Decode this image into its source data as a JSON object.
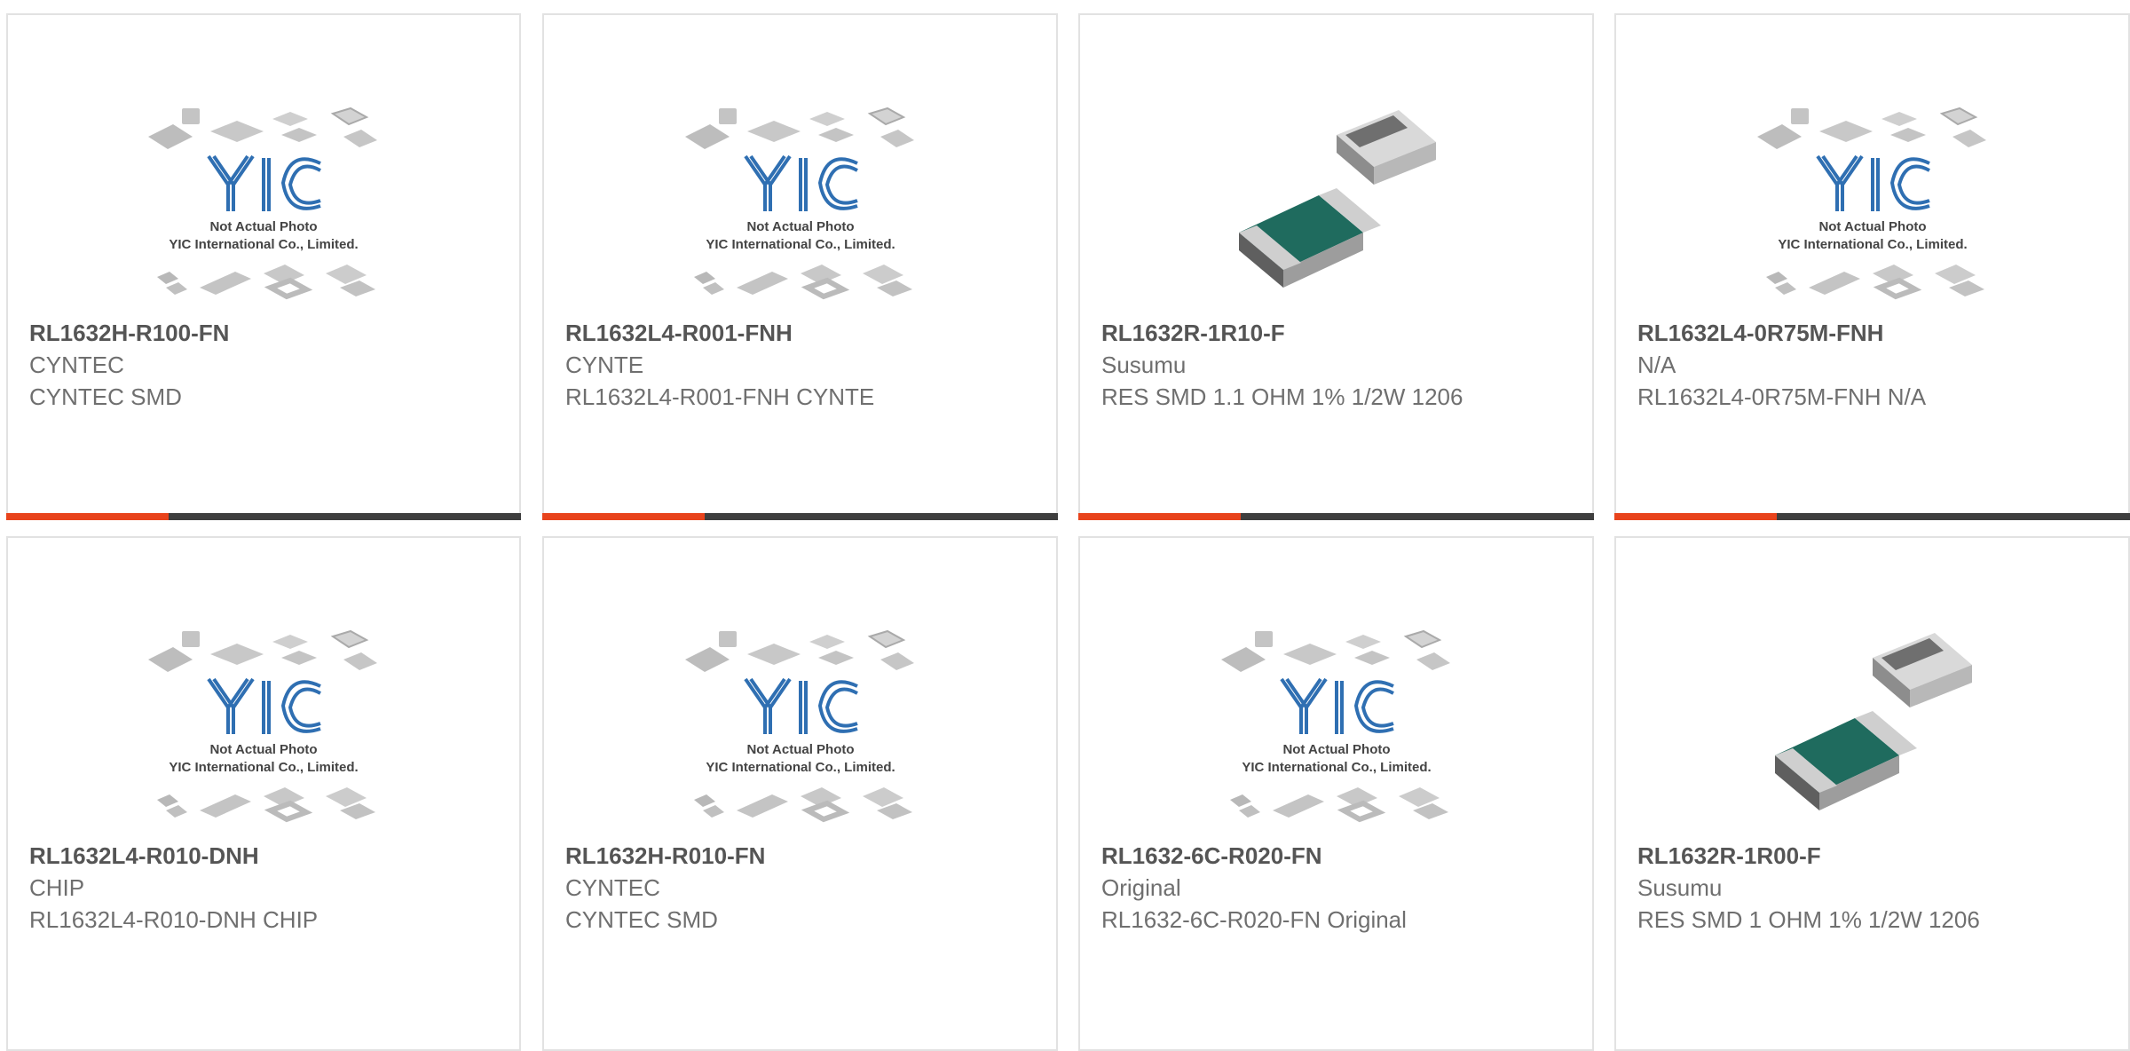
{
  "colors": {
    "accent": "#e8431c",
    "bar_dark": "#3e3e3e",
    "yic_logo_blue": "#2f6fb2",
    "resistor_body": "#1f6b5e"
  },
  "products": [
    {
      "part_number": "RL1632H-R100-FN",
      "manufacturer": "CYNTEC",
      "description": "CYNTEC SMD",
      "image": "placeholder",
      "image_icon": "yic-not-actual-photo",
      "placeholder_text": [
        "Not Actual Photo",
        "YIC International Co., Limited."
      ]
    },
    {
      "part_number": "RL1632L4-R001-FNH",
      "manufacturer": "CYNTE",
      "description": "RL1632L4-R001-FNH CYNTE",
      "image": "placeholder",
      "image_icon": "yic-not-actual-photo",
      "placeholder_text": [
        "Not Actual Photo",
        "YIC International Co., Limited."
      ]
    },
    {
      "part_number": "RL1632R-1R10-F",
      "manufacturer": "Susumu",
      "description": "RES SMD 1.1 OHM 1% 1/2W 1206",
      "image": "resistor",
      "image_icon": "smd-resistor-photo"
    },
    {
      "part_number": "RL1632L4-0R75M-FNH",
      "manufacturer": "N/A",
      "description": "RL1632L4-0R75M-FNH N/A",
      "image": "placeholder",
      "image_icon": "yic-not-actual-photo",
      "placeholder_text": [
        "Not Actual Photo",
        "YIC International Co., Limited."
      ]
    },
    {
      "part_number": "RL1632L4-R010-DNH",
      "manufacturer": "CHIP",
      "description": "RL1632L4-R010-DNH CHIP",
      "image": "placeholder",
      "image_icon": "yic-not-actual-photo",
      "placeholder_text": [
        "Not Actual Photo",
        "YIC International Co., Limited."
      ]
    },
    {
      "part_number": "RL1632H-R010-FN",
      "manufacturer": "CYNTEC",
      "description": "CYNTEC SMD",
      "image": "placeholder",
      "image_icon": "yic-not-actual-photo",
      "placeholder_text": [
        "Not Actual Photo",
        "YIC International Co., Limited."
      ]
    },
    {
      "part_number": "RL1632-6C-R020-FN",
      "manufacturer": "Original",
      "description": "RL1632-6C-R020-FN Original",
      "image": "placeholder",
      "image_icon": "yic-not-actual-photo",
      "placeholder_text": [
        "Not Actual Photo",
        "YIC International Co., Limited."
      ]
    },
    {
      "part_number": "RL1632R-1R00-F",
      "manufacturer": "Susumu",
      "description": "RES SMD 1 OHM 1% 1/2W 1206",
      "image": "resistor",
      "image_icon": "smd-resistor-photo"
    }
  ]
}
